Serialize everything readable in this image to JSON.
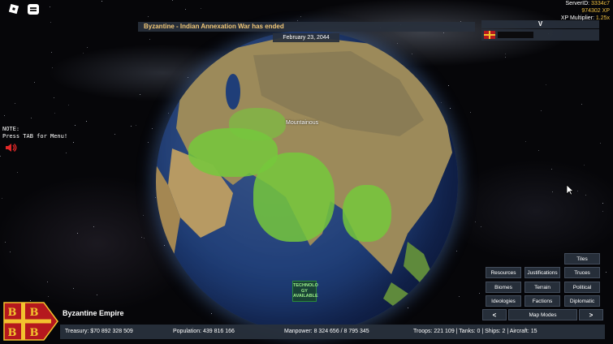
{
  "server": {
    "id_label": "ServerID: ",
    "id_value": "3334c7",
    "xp_value": "974302 XP",
    "multiplier_label": "XP Multiplier: ",
    "multiplier_value": "1.25x"
  },
  "banner": {
    "message": "Byzantine - Indian Annexation War has ended",
    "date": "February 23, 2044"
  },
  "top_right": {
    "label": "V"
  },
  "note": {
    "line1": "NOTE:",
    "line2": "Press TAB for Menu!"
  },
  "globe": {
    "terrain_label": "Mountainous",
    "tech_notice": [
      "TECHNOLO",
      "GY",
      "AVAILABLE"
    ]
  },
  "map_buttons": {
    "tiles": "Tiles",
    "resources": "Resources",
    "justifications": "Justifications",
    "truces": "Truces",
    "biomes": "Biomes",
    "terrain": "Terrain",
    "political": "Political",
    "ideologies": "Ideologies",
    "factions": "Factions",
    "diplomatic": "Diplomatic",
    "prev": "<",
    "map_modes": "Map Modes",
    "next": ">"
  },
  "empire": {
    "name": "Byzantine Empire",
    "treasury": "Treasury:  $70 892 328 509",
    "population": "Population:  439 816 166",
    "manpower": "Manpower:  8 324 656  /  8 795 345",
    "military": "Troops: 221 109  |  Tanks: 0  |  Ships: 2  |  Aircraft: 15"
  },
  "colors": {
    "accent_gold": "#f0c040",
    "banner_text": "#f2c878",
    "panel_bg": "#28303c",
    "flag_red": "#b5181e",
    "flag_gold": "#f2c22e"
  }
}
